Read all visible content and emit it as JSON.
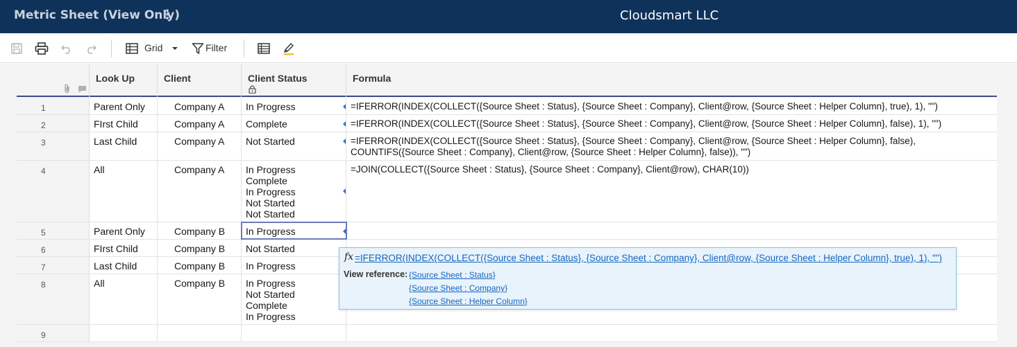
{
  "header": {
    "sheet_title": "Metric Sheet (View Only)",
    "menu_glyph": "⋮",
    "company": "Cloudsmart LLC"
  },
  "toolbar": {
    "grid_label": "Grid",
    "filter_label": "Filter"
  },
  "columns": {
    "lookup": "Look Up",
    "client": "Client",
    "status": "Client Status",
    "formula": "Formula"
  },
  "rows": [
    {
      "num": "1",
      "lookup": "Parent Only",
      "client": "Company A",
      "status": "In Progress",
      "formula": "=IFERROR(INDEX(COLLECT({Source Sheet : Status}, {Source Sheet : Company}, Client@row, {Source Sheet : Helper Column}, true), 1), \"\")"
    },
    {
      "num": "2",
      "lookup": "FIrst Child",
      "client": "Company A",
      "status": "Complete",
      "formula": "=IFERROR(INDEX(COLLECT({Source Sheet : Status}, {Source Sheet : Company}, Client@row, {Source Sheet : Helper Column}, false), 1), \"\")"
    },
    {
      "num": "3",
      "lookup": "Last Child",
      "client": "Company A",
      "status": "Not Started",
      "formula": "=IFERROR(INDEX(COLLECT({Source Sheet : Status}, {Source Sheet : Company}, Client@row, {Source Sheet : Helper Column}, false), COUNTIFS({Source Sheet : Company}, Client@row, {Source Sheet : Helper Column}, false)), \"\")"
    },
    {
      "num": "4",
      "lookup": "All",
      "client": "Company A",
      "status": "In Progress\nComplete\nIn Progress\nNot Started\nNot Started",
      "formula": "=JOIN(COLLECT({Source Sheet : Status}, {Source Sheet : Company}, Client@row), CHAR(10))"
    },
    {
      "num": "5",
      "lookup": "Parent Only",
      "client": "Company B",
      "status": "In Progress",
      "formula": ""
    },
    {
      "num": "6",
      "lookup": "FIrst Child",
      "client": "Company B",
      "status": "Not Started",
      "formula": ""
    },
    {
      "num": "7",
      "lookup": "Last Child",
      "client": "Company B",
      "status": "In Progress",
      "formula": ""
    },
    {
      "num": "8",
      "lookup": "All",
      "client": "Company B",
      "status": "In Progress\nNot Started\nComplete\nIn Progress",
      "formula": ""
    },
    {
      "num": "9",
      "lookup": "",
      "client": "",
      "status": "",
      "formula": ""
    }
  ],
  "popup": {
    "fx": "fx",
    "formula": "=IFERROR(INDEX(COLLECT({Source Sheet : Status}, {Source Sheet : Company}, Client@row, {Source Sheet : Helper Column}, true), 1), \"\")",
    "view_reference_label": "View reference:",
    "references": [
      "{Source Sheet : Status}",
      "{Source Sheet : Company}",
      "{Source Sheet : Helper Column}"
    ]
  }
}
